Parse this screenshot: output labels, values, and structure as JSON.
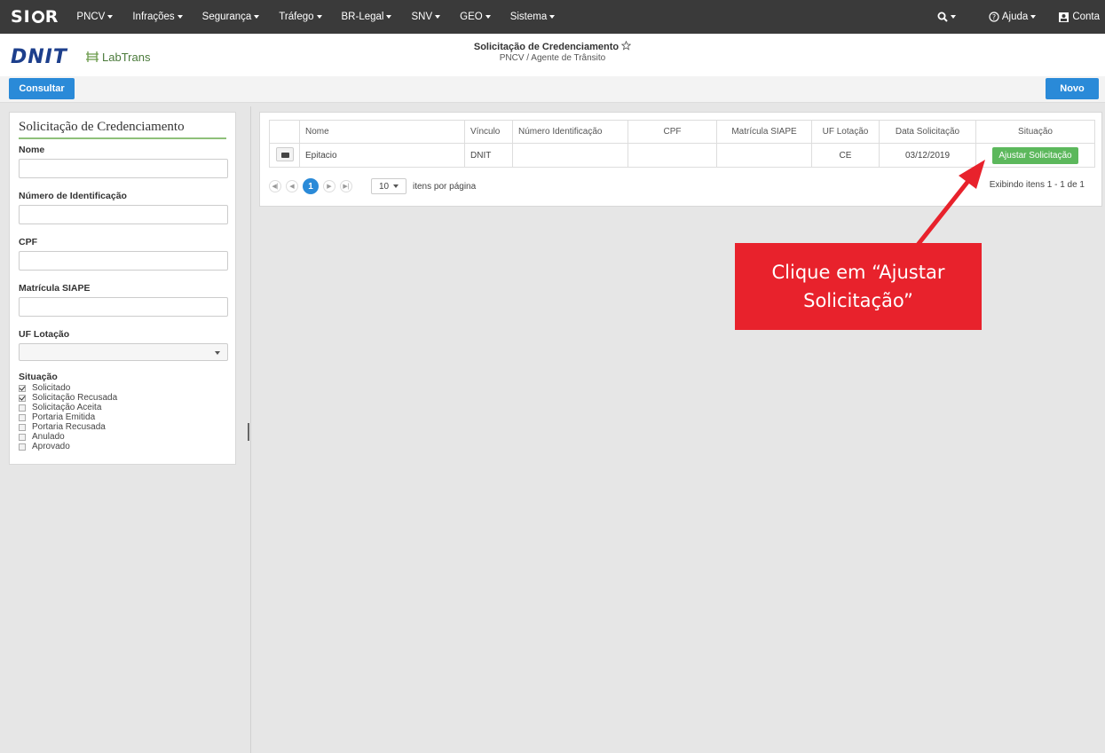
{
  "navbar": {
    "brand": "SIOR",
    "menus": [
      "PNCV",
      "Infrações",
      "Segurança",
      "Tráfego",
      "BR-Legal",
      "SNV",
      "GEO",
      "Sistema"
    ],
    "help_label": "Ajuda",
    "account_label": "Conta"
  },
  "header": {
    "dnit_logo": "DNIT",
    "labtrans_logo": "LabTrans",
    "title": "Solicitação de Credenciamento",
    "breadcrumb": "PNCV / Agente de Trânsito"
  },
  "toolbar": {
    "consult_label": "Consultar",
    "new_label": "Novo"
  },
  "filter": {
    "title": "Solicitação de Credenciamento",
    "fields": {
      "nome": "Nome",
      "numero": "Número de Identificação",
      "cpf": "CPF",
      "matricula": "Matrícula SIAPE",
      "uf": "UF Lotação",
      "situacao": "Situação"
    },
    "situacoes": [
      {
        "label": "Solicitado",
        "checked": true
      },
      {
        "label": "Solicitação Recusada",
        "checked": true
      },
      {
        "label": "Solicitação Aceita",
        "checked": false
      },
      {
        "label": "Portaria Emitida",
        "checked": false
      },
      {
        "label": "Portaria Recusada",
        "checked": false
      },
      {
        "label": "Anulado",
        "checked": false
      },
      {
        "label": "Aprovado",
        "checked": false
      }
    ]
  },
  "grid": {
    "columns": [
      "Nome",
      "Vínculo",
      "Número Identificação",
      "CPF",
      "Matrícula SIAPE",
      "UF Lotação",
      "Data Solicitação",
      "Situação"
    ],
    "rows": [
      {
        "nome": "Epitacio",
        "vinculo": "DNIT",
        "numero": "",
        "cpf": "",
        "matricula": "",
        "uf": "CE",
        "data": "03/12/2019",
        "action": "Ajustar Solicitação"
      }
    ],
    "pager": {
      "current_page": "1",
      "page_size": "10",
      "per_page_label": "itens por página",
      "showing": "Exibindo itens 1 - 1 de 1"
    }
  },
  "annotation": {
    "line1": "Clique em “Ajustar",
    "line2": "Solicitação”",
    "color": "#e8222c"
  }
}
